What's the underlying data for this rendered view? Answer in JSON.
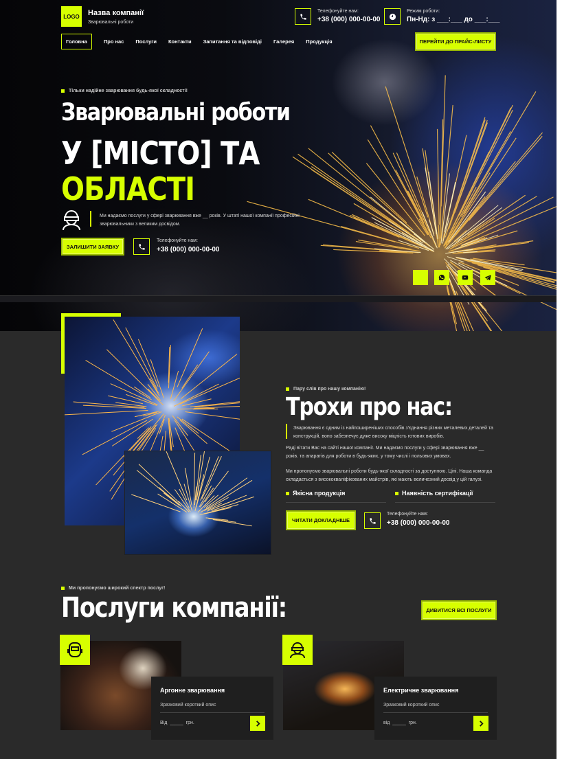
{
  "header": {
    "logo": "LOGO",
    "company_name": "Назва компанії",
    "company_tagline": "Зварювальні роботи",
    "phone_label": "Телефонуйте нам:",
    "phone": "+38 (000) 000-00-00",
    "hours_label": "Режим роботи:",
    "hours": "Пн-Нд: з ___:___ до ___:___"
  },
  "nav": {
    "items": [
      "Головна",
      "Про нас",
      "Послуги",
      "Контакти",
      "Запитання та відповіді",
      "Галерея",
      "Продукція"
    ],
    "active": "Головна",
    "price_button": "ПЕРЕЙТИ ДО ПРАЙС-ЛИСТУ"
  },
  "hero": {
    "kicker": "Тільки надійне зварювання будь-якої складності!",
    "title_line1": "Зварювальні роботи",
    "title_line2": "У [МІСТО] ТА",
    "title_line3": "ОБЛАСТІ",
    "description": "Ми надаємо послуги у сфері зварювання вже __ років. У штаті нашої компанії професійні зварювальники з великим досвідом.",
    "cta_button": "ЗАЛИШИТИ ЗАЯВКУ",
    "phone_label": "Телефонуйте нам:",
    "phone": "+38 (000) 000-00-00"
  },
  "about": {
    "kicker": "Пару слів про нашу компанію!",
    "title": "Трохи про нас:",
    "lead": "Зварювання є одним із найпоширеніших способів з'єднання різних металевих деталей та конструкцій, воно забезпечує дуже високу міцність готових виробів.",
    "para1": "Раді вітати Вас на сайті нашої компанії. Ми надаємо послуги у сфері зварювання вже __ років. та апаратів для роботи в будь-яких, у тому числі і польових умовах.",
    "para2": "Ми пропонуємо зварювальні роботи будь-якої складності за доступною. Ціні. Наша команда складається з висококваліфікованих майстрів, які мають величезний досвід у цій галузі.",
    "feature1": "Якісна продукція",
    "feature2": "Наявність сертифікації",
    "more_button": "ЧИТАТИ ДОКЛАДНІШЕ",
    "phone_label": "Телефонуйте нам:",
    "phone": "+38 (000) 000-00-00"
  },
  "services": {
    "kicker": "Ми пропонуємо широкий спектр послуг!",
    "title": "Послуги компанії:",
    "all_button": "ДИВИТИСЯ ВСІ ПОСЛУГИ",
    "cards": [
      {
        "title": "Аргонне зварювання",
        "desc": "Зразковий короткий опис",
        "price_from": "Від",
        "price_blank": "_____",
        "currency": "грн."
      },
      {
        "title": "Електричне зварювання",
        "desc": "Зразковий короткий опис",
        "price_from": "від",
        "price_blank": "_____",
        "currency": "грн."
      }
    ]
  },
  "colors": {
    "accent": "#d7ff00",
    "background": "#2a2a2a",
    "card": "#1f1f1f"
  }
}
